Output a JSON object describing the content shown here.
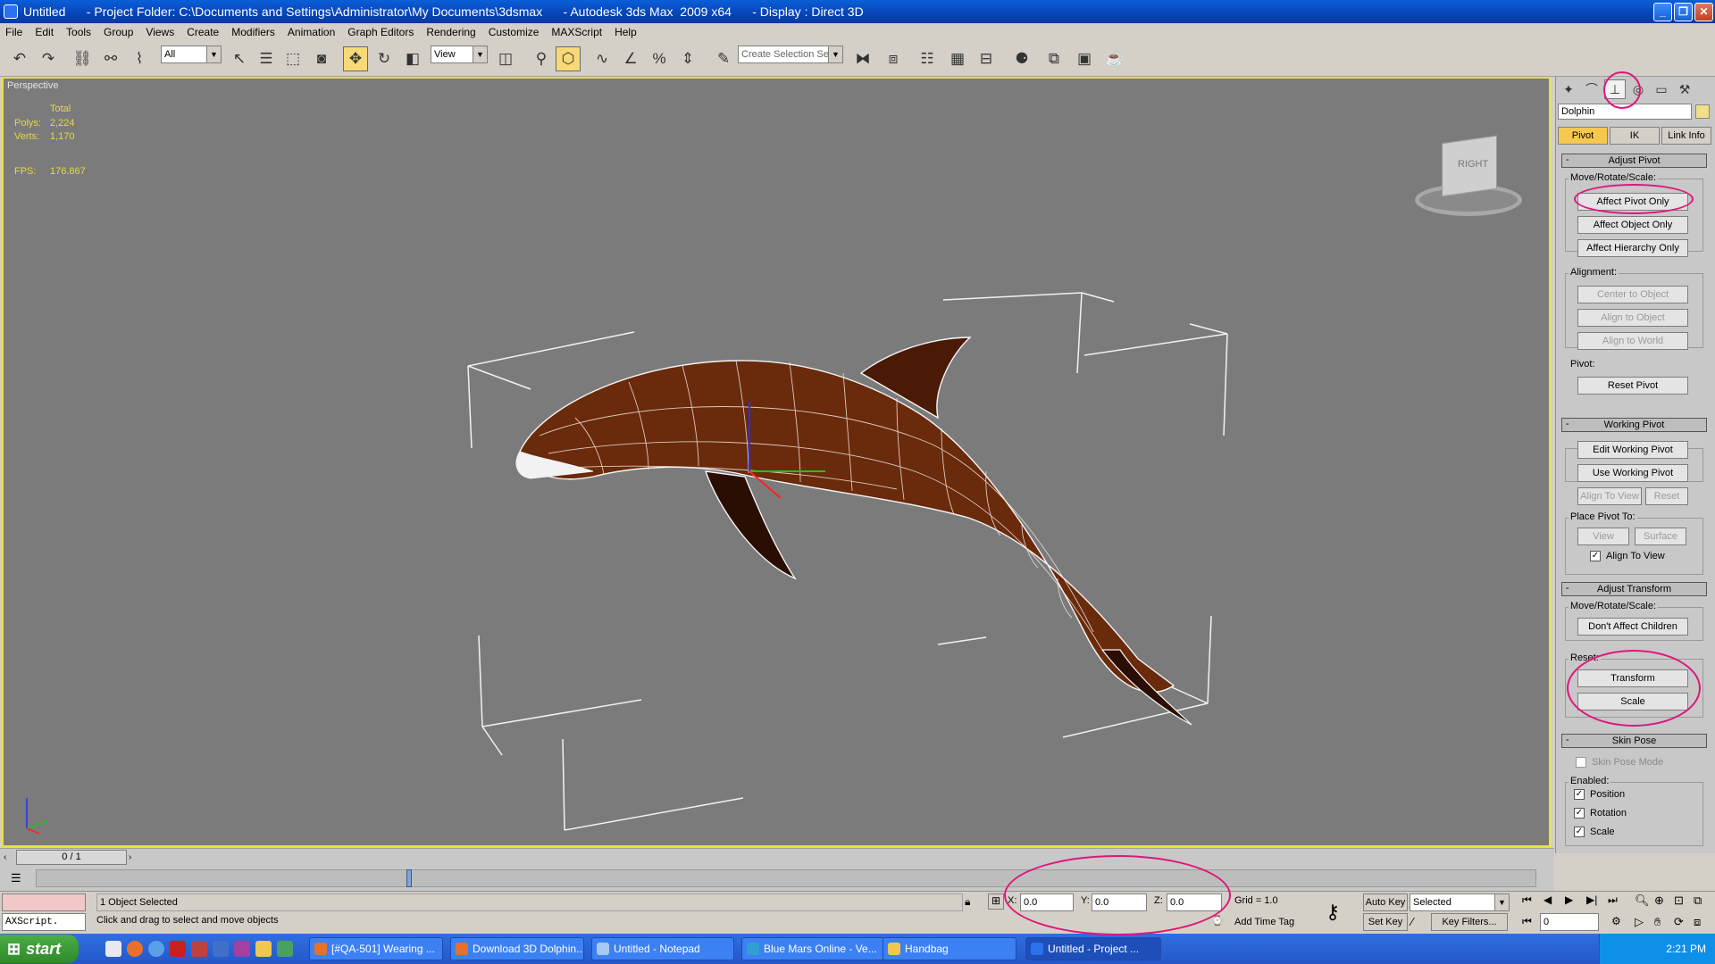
{
  "window": {
    "title": "Untitled      - Project Folder: C:\\Documents and Settings\\Administrator\\My Documents\\3dsmax      - Autodesk 3ds Max  2009 x64      - Display : Direct 3D"
  },
  "menu": [
    "File",
    "Edit",
    "Tools",
    "Group",
    "Views",
    "Create",
    "Modifiers",
    "Animation",
    "Graph Editors",
    "Rendering",
    "Customize",
    "MAXScript",
    "Help"
  ],
  "toolbar": {
    "selection_filter": "All",
    "ref_coord": "View",
    "named_selection": "Create Selection Set"
  },
  "viewport": {
    "label": "Perspective",
    "stats": {
      "header": "Total",
      "polys_label": "Polys:",
      "polys": "2,224",
      "verts_label": "Verts:",
      "verts": "1,170",
      "fps_label": "FPS:",
      "fps": "176.867"
    },
    "viewcube_face": "RIGHT"
  },
  "command_panel": {
    "object_name": "Dolphin",
    "sub_tabs": [
      "Pivot",
      "IK",
      "Link Info"
    ],
    "adjust_pivot": {
      "title": "Adjust Pivot",
      "move_group": "Move/Rotate/Scale:",
      "buttons": [
        "Affect Pivot Only",
        "Affect Object Only",
        "Affect Hierarchy Only"
      ],
      "alignment_group": "Alignment:",
      "alignment_buttons": [
        "Center to Object",
        "Align to Object",
        "Align to World"
      ],
      "pivot_group": "Pivot:",
      "reset_pivot": "Reset Pivot"
    },
    "working_pivot": {
      "title": "Working Pivot",
      "edit": "Edit Working Pivot",
      "use": "Use Working Pivot",
      "align_to_view": "Align To View",
      "reset": "Reset",
      "place_group": "Place Pivot To:",
      "view": "View",
      "surface": "Surface",
      "align_check": "Align To View"
    },
    "adjust_transform": {
      "title": "Adjust Transform",
      "move_group": "Move/Rotate/Scale:",
      "dont_affect": "Don't Affect Children",
      "reset_group": "Reset:",
      "transform": "Transform",
      "scale": "Scale"
    },
    "skin_pose": {
      "title": "Skin Pose",
      "mode": "Skin Pose Mode",
      "enabled": "Enabled:",
      "position": "Position",
      "rotation": "Rotation",
      "scale": "Scale"
    }
  },
  "timeline": {
    "frame_display": "0 / 1"
  },
  "status": {
    "maxscript": "AXScript.",
    "selected": "1 Object Selected",
    "prompt": "Click and drag to select and move objects",
    "x_label": "X:",
    "x": "0.0",
    "y_label": "Y:",
    "y": "0.0",
    "z_label": "Z:",
    "z": "0.0",
    "grid": "Grid = 1.0",
    "add_time_tag": "Add Time Tag",
    "auto_key": "Auto Key",
    "set_key": "Set Key",
    "key_mode": "Selected",
    "key_filters": "Key Filters...",
    "frame": "0"
  },
  "taskbar": {
    "start": "start",
    "tasks": [
      "[#QA-501] Wearing ...",
      "Download 3D Dolphin...",
      "Untitled - Notepad",
      "Blue Mars Online - Ve...",
      "Handbag",
      "Untitled       - Project ..."
    ],
    "clock": "2:21 PM"
  },
  "colors": {
    "viewport_bg": "#7b7b7b",
    "active_border": "#e8e23a",
    "highlight_circle": "#e0157a",
    "dolphin": "#6a2a0c"
  }
}
